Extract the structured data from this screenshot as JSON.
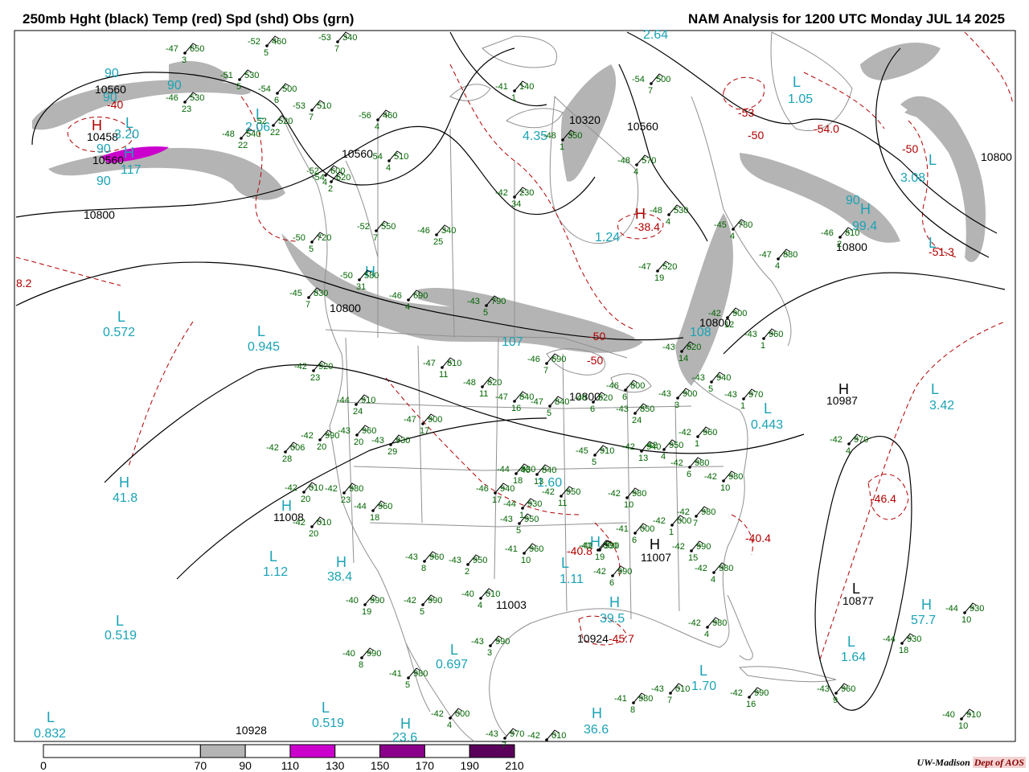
{
  "header": {
    "left_title": "250mb Hght (black) Temp (red) Spd (shd) Obs (grn)",
    "right_title": "NAM Analysis for 1200 UTC Monday  JUL 14 2025"
  },
  "colors": {
    "height": "#000000",
    "temp": "#b00000",
    "speed_label": "#1aa3b5",
    "obs": "#006400",
    "border": "#909090",
    "shade_70": "#b4b4b4",
    "shade_110": "#cc00cc",
    "shade_150": "#8b008b",
    "shade_190": "#5a005a"
  },
  "height_labels": [
    {
      "id": "h-10560-nw",
      "text": "10560"
    },
    {
      "id": "h-10458",
      "text": "10458"
    },
    {
      "id": "h-10560-nw2",
      "text": "10560"
    },
    {
      "id": "h-10560-pac",
      "text": "10560"
    },
    {
      "id": "h-10800-pac",
      "text": "10800"
    },
    {
      "id": "h-10320",
      "text": "10320"
    },
    {
      "id": "h-10560-hud",
      "text": "10560"
    },
    {
      "id": "h-10800-e",
      "text": "10800"
    },
    {
      "id": "h-10800-atl",
      "text": "10800"
    },
    {
      "id": "h-10800-bc",
      "text": "10800"
    },
    {
      "id": "h-10800-gl",
      "text": "10800"
    },
    {
      "id": "h-10800-oh",
      "text": "10800"
    },
    {
      "id": "h-10987",
      "text": "10987"
    },
    {
      "id": "h-11008",
      "text": "11008"
    },
    {
      "id": "h-11003",
      "text": "11003"
    },
    {
      "id": "h-11007",
      "text": "11007"
    },
    {
      "id": "h-10877",
      "text": "10877"
    },
    {
      "id": "h-10924",
      "text": "10924"
    },
    {
      "id": "h-10928",
      "text": "10928"
    }
  ],
  "temp_labels": [
    {
      "id": "t-40",
      "text": "-40"
    },
    {
      "id": "t-54",
      "text": "-54.0"
    },
    {
      "id": "t-50a",
      "text": "-50"
    },
    {
      "id": "t-50b",
      "text": "-50"
    },
    {
      "id": "t-51",
      "text": "-51.3"
    },
    {
      "id": "t-53",
      "text": "-53"
    },
    {
      "id": "t-384",
      "text": "-38.4"
    },
    {
      "id": "t-50c",
      "text": "-50"
    },
    {
      "id": "t-50d",
      "text": "-50"
    },
    {
      "id": "t-464",
      "text": "-46.4"
    },
    {
      "id": "t-404",
      "text": "-40.4"
    },
    {
      "id": "t-408",
      "text": "-40.8"
    },
    {
      "id": "t-457",
      "text": "-45.7"
    },
    {
      "id": "t-edge",
      "text": "8.2"
    }
  ],
  "speed_labels": [
    {
      "id": "s-90a",
      "text": "90"
    },
    {
      "id": "s-90b",
      "text": "90"
    },
    {
      "id": "s-90c",
      "text": "90"
    },
    {
      "id": "s-90d",
      "text": "90"
    },
    {
      "id": "s-320",
      "text": "3.20"
    },
    {
      "id": "s-117",
      "text": "117"
    },
    {
      "id": "s-90e",
      "text": "90"
    },
    {
      "id": "s-264",
      "text": "2.64"
    },
    {
      "id": "s-105",
      "text": "1.05"
    },
    {
      "id": "s-308",
      "text": "3.08"
    },
    {
      "id": "s-435",
      "text": "4.35"
    },
    {
      "id": "s-206",
      "text": "2.06"
    },
    {
      "id": "s-124",
      "text": "1.24"
    },
    {
      "id": "s-994",
      "text": "99.4"
    },
    {
      "id": "s-90f",
      "text": "90"
    },
    {
      "id": "s-0572",
      "text": "0.572"
    },
    {
      "id": "s-0945",
      "text": "0.945"
    },
    {
      "id": "s-107",
      "text": "107"
    },
    {
      "id": "s-108",
      "text": "108"
    },
    {
      "id": "s-0443",
      "text": "0.443"
    },
    {
      "id": "s-342",
      "text": "3.42"
    },
    {
      "id": "s-418",
      "text": "41.8"
    },
    {
      "id": "s-160",
      "text": "1.60"
    },
    {
      "id": "s-112",
      "text": "1.12"
    },
    {
      "id": "s-384",
      "text": "38.4"
    },
    {
      "id": "s-111",
      "text": "1.11"
    },
    {
      "id": "s-395",
      "text": "39.5"
    },
    {
      "id": "s-577",
      "text": "57.7"
    },
    {
      "id": "s-0519a",
      "text": "0.519"
    },
    {
      "id": "s-0697",
      "text": "0.697"
    },
    {
      "id": "s-164",
      "text": "1.64"
    },
    {
      "id": "s-170",
      "text": "1.70"
    },
    {
      "id": "s-0832",
      "text": "0.832"
    },
    {
      "id": "s-0519b",
      "text": "0.519"
    },
    {
      "id": "s-236",
      "text": "23.6"
    },
    {
      "id": "s-366",
      "text": "36.6"
    }
  ],
  "extrema_letters": [
    {
      "id": "x-H-nw",
      "text": "H"
    },
    {
      "id": "x-L-nw",
      "text": "L"
    },
    {
      "id": "x-H-nw2",
      "text": "H"
    },
    {
      "id": "x-L-ak",
      "text": "L"
    },
    {
      "id": "x-L-hud",
      "text": "L"
    },
    {
      "id": "x-H-que",
      "text": "H"
    },
    {
      "id": "x-L-gr",
      "text": "L"
    },
    {
      "id": "x-L-atl",
      "text": "L"
    },
    {
      "id": "x-H-atl",
      "text": "H"
    },
    {
      "id": "x-L-pac1",
      "text": "L"
    },
    {
      "id": "x-L-pac2",
      "text": "L"
    },
    {
      "id": "x-H-bc",
      "text": "H"
    },
    {
      "id": "x-L-ne",
      "text": "L"
    },
    {
      "id": "x-H-at2",
      "text": "H"
    },
    {
      "id": "x-L-at3",
      "text": "L"
    },
    {
      "id": "x-H-pac3",
      "text": "H"
    },
    {
      "id": "x-H-sw",
      "text": "H"
    },
    {
      "id": "x-L-sw",
      "text": "L"
    },
    {
      "id": "x-H-az",
      "text": "H"
    },
    {
      "id": "x-L-ok",
      "text": "L"
    },
    {
      "id": "x-H-gulf",
      "text": "H"
    },
    {
      "id": "x-H-se",
      "text": "H"
    },
    {
      "id": "x-H-car",
      "text": "H"
    },
    {
      "id": "x-L-car",
      "text": "L"
    },
    {
      "id": "x-L-car2",
      "text": "L"
    },
    {
      "id": "x-L-pac4",
      "text": "L"
    },
    {
      "id": "x-L-pac5",
      "text": "L"
    },
    {
      "id": "x-L-mx",
      "text": "L"
    },
    {
      "id": "x-H-mx",
      "text": "H"
    },
    {
      "id": "x-H-gulf2",
      "text": "H"
    },
    {
      "id": "x-L-bah",
      "text": "L"
    },
    {
      "id": "x-L-pac6",
      "text": "L"
    },
    {
      "id": "x-H-gulf3",
      "text": "H"
    }
  ],
  "observations": [
    {
      "id": "o1",
      "t": "-47",
      "z": "650",
      "d": "3"
    },
    {
      "id": "o2",
      "t": "-52",
      "z": "460",
      "d": "5"
    },
    {
      "id": "o3",
      "t": "-53",
      "z": "340",
      "d": "7"
    },
    {
      "id": "o4",
      "t": "-51",
      "z": "530",
      "d": "5"
    },
    {
      "id": "o5",
      "t": "-54",
      "z": "500",
      "d": "6"
    },
    {
      "id": "o6",
      "t": "-53",
      "z": "510",
      "d": "7"
    },
    {
      "id": "o7",
      "t": "-46",
      "z": "530",
      "d": "23"
    },
    {
      "id": "o8",
      "t": "-52",
      "z": "520",
      "d": "22"
    },
    {
      "id": "o9",
      "t": "-48",
      "z": "540",
      "d": "22"
    },
    {
      "id": "o10",
      "t": "-56",
      "z": "460",
      "d": "4"
    },
    {
      "id": "o11",
      "t": "-54",
      "z": "510",
      "d": "4"
    },
    {
      "id": "o12",
      "t": "-52",
      "z": "600",
      "d": "4"
    },
    {
      "id": "o13",
      "t": "-54",
      "z": "620",
      "d": "2"
    },
    {
      "id": "o14",
      "t": "-41",
      "z": "140",
      "d": "1"
    },
    {
      "id": "o15",
      "t": "-48",
      "z": "350",
      "d": "1"
    },
    {
      "id": "o16",
      "t": "-54",
      "z": "500",
      "d": "7"
    },
    {
      "id": "o17",
      "t": "-48",
      "z": "570",
      "d": "4"
    },
    {
      "id": "o18",
      "t": "-42",
      "z": "230",
      "d": "34"
    },
    {
      "id": "o19",
      "t": "-48",
      "z": "530",
      "d": "4"
    },
    {
      "id": "o20",
      "t": "-52",
      "z": "550",
      "d": "7"
    },
    {
      "id": "o21",
      "t": "-46",
      "z": "340",
      "d": "25"
    },
    {
      "id": "o22",
      "t": "-50",
      "z": "720",
      "d": "5"
    },
    {
      "id": "o23",
      "t": "-45",
      "z": "780",
      "d": "4"
    },
    {
      "id": "o24",
      "t": "-46",
      "z": "810",
      "d": "2"
    },
    {
      "id": "o25",
      "t": "-47",
      "z": "880",
      "d": "4"
    },
    {
      "id": "o26",
      "t": "-47",
      "z": "520",
      "d": "19"
    },
    {
      "id": "o27",
      "t": "-50",
      "z": "580",
      "d": "31"
    },
    {
      "id": "o28",
      "t": "-45",
      "z": "830",
      "d": "7"
    },
    {
      "id": "o29",
      "t": "-46",
      "z": "690",
      "d": "4"
    },
    {
      "id": "o30",
      "t": "-43",
      "z": "790",
      "d": "5"
    },
    {
      "id": "o31",
      "t": "-42",
      "z": "900",
      "d": "12"
    },
    {
      "id": "o32",
      "t": "-43",
      "z": "960",
      "d": "1"
    },
    {
      "id": "o33",
      "t": "-43",
      "z": "820",
      "d": "14"
    },
    {
      "id": "o34",
      "t": "-42",
      "z": "920",
      "d": "23"
    },
    {
      "id": "o35",
      "t": "-47",
      "z": "810",
      "d": "11"
    },
    {
      "id": "o36",
      "t": "-46",
      "z": "690",
      "d": "7"
    },
    {
      "id": "o37",
      "t": "-48",
      "z": "820",
      "d": "11"
    },
    {
      "id": "o38",
      "t": "-47",
      "z": "840",
      "d": "16"
    },
    {
      "id": "o39",
      "t": "-47",
      "z": "840",
      "d": "5"
    },
    {
      "id": "o40",
      "t": "-46",
      "z": "820",
      "d": "6"
    },
    {
      "id": "o41",
      "t": "-46",
      "z": "800",
      "d": "6"
    },
    {
      "id": "o42",
      "t": "-43",
      "z": "940",
      "d": "5"
    },
    {
      "id": "o43",
      "t": "-43",
      "z": "900",
      "d": "3"
    },
    {
      "id": "o44",
      "t": "-43",
      "z": "970",
      "d": "1"
    },
    {
      "id": "o45",
      "t": "-43",
      "z": "850",
      "d": "24"
    },
    {
      "id": "o46",
      "t": "-44",
      "z": "910",
      "d": "24"
    },
    {
      "id": "o47",
      "t": "-47",
      "z": "900",
      "d": "17"
    },
    {
      "id": "o48",
      "t": "-42",
      "z": "990",
      "d": "20"
    },
    {
      "id": "o49",
      "t": "-43",
      "z": "960",
      "d": "20"
    },
    {
      "id": "o50",
      "t": "-43",
      "z": "930",
      "d": "29"
    },
    {
      "id": "o51",
      "t": "-42",
      "z": "006",
      "d": "28"
    },
    {
      "id": "o52",
      "t": "-45",
      "z": "910",
      "d": "5"
    },
    {
      "id": "o53",
      "t": "-42",
      "z": "940",
      "d": "13"
    },
    {
      "id": "o54",
      "t": "-42",
      "z": "950",
      "d": "4"
    },
    {
      "id": "o55",
      "t": "-42",
      "z": "960",
      "d": "1"
    },
    {
      "id": "o56",
      "t": "-44",
      "z": "930",
      "d": "18"
    },
    {
      "id": "o57",
      "t": "-42",
      "z": "010",
      "d": "20"
    },
    {
      "id": "o58",
      "t": "-42",
      "z": "980",
      "d": "23"
    },
    {
      "id": "o59",
      "t": "-46",
      "z": "840",
      "d": "13"
    },
    {
      "id": "o60",
      "t": "-46",
      "z": "940",
      "d": "17"
    },
    {
      "id": "o61",
      "t": "-42",
      "z": "950",
      "d": "11"
    },
    {
      "id": "o62",
      "t": "-42",
      "z": "980",
      "d": "10"
    },
    {
      "id": "o63",
      "t": "-42",
      "z": "980",
      "d": "6"
    },
    {
      "id": "o64",
      "t": "-42",
      "z": "980",
      "d": "10"
    },
    {
      "id": "o65",
      "t": "-44",
      "z": "960",
      "d": "18"
    },
    {
      "id": "o66",
      "t": "-44",
      "z": "930",
      "d": "1"
    },
    {
      "id": "o67",
      "t": "-43",
      "z": "950",
      "d": "5"
    },
    {
      "id": "o68",
      "t": "-42",
      "z": "010",
      "d": "20"
    },
    {
      "id": "o69",
      "t": "-42",
      "z": "980",
      "d": "7"
    },
    {
      "id": "o70",
      "t": "-41",
      "z": "000",
      "d": "6"
    },
    {
      "id": "o71",
      "t": "-42",
      "z": "000",
      "d": "1"
    },
    {
      "id": "o72",
      "t": "-41",
      "z": "960",
      "d": "10"
    },
    {
      "id": "o73",
      "t": "-42",
      "z": "990",
      "d": "15"
    },
    {
      "id": "o74",
      "t": "-43",
      "z": "960",
      "d": "8"
    },
    {
      "id": "o75",
      "t": "-43",
      "z": "950",
      "d": "2"
    },
    {
      "id": "o76",
      "t": "-41",
      "z": "000",
      "d": "19"
    },
    {
      "id": "o77",
      "t": "-42",
      "z": "990",
      "d": "6"
    },
    {
      "id": "o78",
      "t": "-42",
      "z": "980",
      "d": "4"
    },
    {
      "id": "o79",
      "t": "-40",
      "z": "990",
      "d": "19"
    },
    {
      "id": "o80",
      "t": "-42",
      "z": "990",
      "d": "5"
    },
    {
      "id": "o81",
      "t": "-40",
      "z": "010",
      "d": "4"
    },
    {
      "id": "o82",
      "t": "-42",
      "z": "980",
      "d": "4"
    },
    {
      "id": "o83",
      "t": "-42",
      "z": "970",
      "d": "4"
    },
    {
      "id": "o84",
      "t": "-44",
      "z": "930",
      "d": "18"
    },
    {
      "id": "o85",
      "t": "-44",
      "z": "930",
      "d": "10"
    },
    {
      "id": "o86",
      "t": "-43",
      "z": "990",
      "d": "3"
    },
    {
      "id": "o87",
      "t": "-40",
      "z": "990",
      "d": "8"
    },
    {
      "id": "o88",
      "t": "-41",
      "z": "980",
      "d": "5"
    },
    {
      "id": "o89",
      "t": "-42",
      "z": "000",
      "d": "4"
    },
    {
      "id": "o90",
      "t": "-41",
      "z": "980",
      "d": "8"
    },
    {
      "id": "o91",
      "t": "-43",
      "z": "010",
      "d": "7"
    },
    {
      "id": "o92",
      "t": "-42",
      "z": "990",
      "d": "16"
    },
    {
      "id": "o93",
      "t": "-43",
      "z": "960",
      "d": "9"
    },
    {
      "id": "o94",
      "t": "-40",
      "z": "910",
      "d": "10"
    },
    {
      "id": "o95",
      "t": "-43",
      "z": "970",
      "d": "7"
    },
    {
      "id": "o96",
      "t": "-42",
      "z": "010",
      "d": ""
    },
    {
      "id": "o97",
      "t": "-41",
      "z": "990",
      "d": ""
    },
    {
      "id": "o98",
      "t": "-41",
      "z": "000",
      "d": ""
    }
  ],
  "colorbar": {
    "bins": [
      {
        "from": "0",
        "to": "70",
        "color": "#ffffff"
      },
      {
        "from": "70",
        "to": "90",
        "color": "#b4b4b4"
      },
      {
        "from": "90",
        "to": "110",
        "color": "#ffffff"
      },
      {
        "from": "110",
        "to": "130",
        "color": "#cc00cc"
      },
      {
        "from": "130",
        "to": "150",
        "color": "#ffffff"
      },
      {
        "from": "150",
        "to": "170",
        "color": "#8b008b"
      },
      {
        "from": "170",
        "to": "190",
        "color": "#ffffff"
      },
      {
        "from": "190",
        "to": "210",
        "color": "#5a005a"
      }
    ],
    "tick_labels": [
      "0",
      "70",
      "90",
      "110",
      "130",
      "150",
      "170",
      "190",
      "210"
    ]
  },
  "credit": {
    "main": "UW-Madison",
    "dept": "Dept of AOS"
  }
}
